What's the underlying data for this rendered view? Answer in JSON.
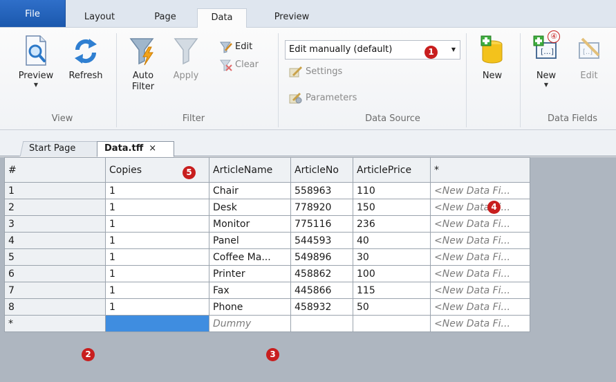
{
  "menu_tabs": [
    "File",
    "Layout",
    "Page",
    "Data",
    "Preview"
  ],
  "ribbon": {
    "view": {
      "caption": "View",
      "preview_label": "Preview",
      "refresh_label": "Refresh"
    },
    "filter": {
      "caption": "Filter",
      "auto_filter_label_1": "Auto",
      "auto_filter_label_2": "Filter",
      "apply_label": "Apply",
      "edit_label": "Edit",
      "clear_label": "Clear"
    },
    "data_source": {
      "caption": "Data Source",
      "mode_value": "Edit manually (default)",
      "settings_label": "Settings",
      "parameters_label": "Parameters",
      "new_label": "New"
    },
    "data_fields": {
      "caption": "Data Fields",
      "new_label": "New",
      "edit_label": "Edit"
    }
  },
  "badges": {
    "b1": "1",
    "b2": "2",
    "b3": "3",
    "b4": "4",
    "b4_ribbon": "④",
    "b5": "5"
  },
  "doc_tabs": {
    "start": "Start Page",
    "current": "Data.tff",
    "close": "×"
  },
  "grid": {
    "headers": [
      "#",
      "Copies",
      "ArticleName",
      "ArticleNo",
      "ArticlePrice",
      "*"
    ],
    "rows": [
      [
        "1",
        "1",
        "Chair",
        "558963",
        "110",
        "<New Data Fi..."
      ],
      [
        "2",
        "1",
        "Desk",
        "778920",
        "150",
        "<New Data Fi..."
      ],
      [
        "3",
        "1",
        "Monitor",
        "775116",
        "236",
        "<New Data Fi..."
      ],
      [
        "4",
        "1",
        "Panel",
        "544593",
        "40",
        "<New Data Fi..."
      ],
      [
        "5",
        "1",
        "Coffee Ma...",
        "549896",
        "30",
        "<New Data Fi..."
      ],
      [
        "6",
        "1",
        "Printer",
        "458862",
        "100",
        "<New Data Fi..."
      ],
      [
        "7",
        "1",
        "Fax",
        "445866",
        "115",
        "<New Data Fi..."
      ],
      [
        "8",
        "1",
        "Phone",
        "458932",
        "50",
        "<New Data Fi..."
      ]
    ],
    "new_row": [
      "*",
      "",
      "Dummy",
      "",
      "",
      "<New Data Fi..."
    ]
  },
  "colors": {
    "accent": "#1b58ad",
    "selection": "#3f8de0",
    "badge": "#c81e1e"
  }
}
